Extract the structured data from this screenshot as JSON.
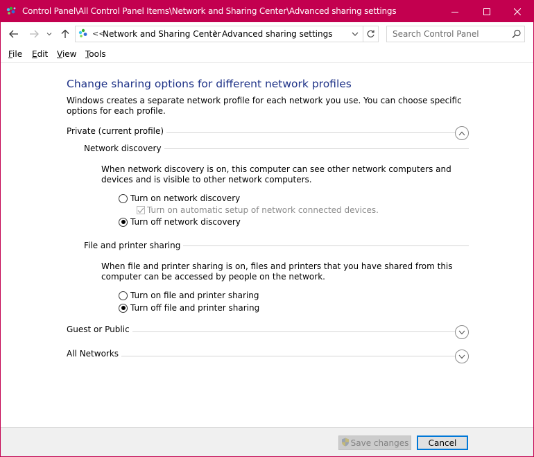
{
  "window": {
    "title": "Control Panel\\All Control Panel Items\\Network and Sharing Center\\Advanced sharing settings",
    "accent_color": "#c3004f"
  },
  "address": {
    "overflow": "<<",
    "crumbs": [
      "Network and Sharing Center",
      "Advanced sharing settings"
    ]
  },
  "search": {
    "placeholder": "Search Control Panel"
  },
  "menu": {
    "file": {
      "key": "F",
      "rest": "ile"
    },
    "edit": {
      "key": "E",
      "rest": "dit"
    },
    "view": {
      "key": "V",
      "rest": "iew"
    },
    "tools": {
      "key": "T",
      "rest": "ools"
    }
  },
  "page": {
    "heading": "Change sharing options for different network profiles",
    "intro": "Windows creates a separate network profile for each network you use. You can choose specific options for each profile."
  },
  "private": {
    "label": "Private (current profile)",
    "network_discovery": {
      "label": "Network discovery",
      "description": "When network discovery is on, this computer can see other network computers and devices and is visible to other network computers.",
      "option_on": "Turn on network discovery",
      "auto_setup": "Turn on automatic setup of network connected devices.",
      "option_off": "Turn off network discovery"
    },
    "file_sharing": {
      "label": "File and printer sharing",
      "description": "When file and printer sharing is on, files and printers that you have shared from this computer can be accessed by people on the network.",
      "option_on": "Turn on file and printer sharing",
      "option_off": "Turn off file and printer sharing"
    }
  },
  "guest": {
    "label": "Guest or Public"
  },
  "all_networks": {
    "label": "All Networks"
  },
  "footer": {
    "save_label": "Save changes",
    "cancel_label": "Cancel"
  }
}
